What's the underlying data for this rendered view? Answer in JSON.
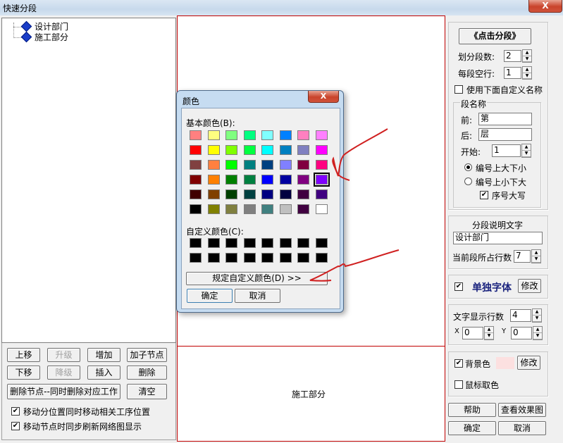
{
  "window": {
    "title": "快速分段",
    "close": "X"
  },
  "tree": {
    "items": [
      "设计部门",
      "施工部分"
    ]
  },
  "left_buttons": {
    "up": "上移",
    "promote": "升级",
    "add": "增加",
    "add_child": "加子节点",
    "down": "下移",
    "demote": "降级",
    "insert": "插入",
    "delete": "删除",
    "delete_node": "删除节点--同时删除对应工作",
    "clear": "清空"
  },
  "left_checks": {
    "move_pos": "移动分位置同时移动相关工序位置",
    "move_refresh": "移动节点时同步刷新网络图显示"
  },
  "canvas": {
    "section2": "施工部分"
  },
  "right": {
    "click_btn": "《点击分段》",
    "seg_count_label": "划分段数:",
    "seg_count": "2",
    "blank_rows_label": "每段空行:",
    "blank_rows": "1",
    "use_custom_label": "使用下面自定义名称",
    "seg_name_group": "段名称",
    "prefix_label": "前:",
    "prefix": "第",
    "suffix_label": "后:",
    "suffix": "层",
    "start_label": "开始:",
    "start": "1",
    "radio1": "编号上大下小",
    "radio2": "编号上小下大",
    "uppercase": "序号大写",
    "desc_group": "分段说明文字",
    "desc_value": "设计部门",
    "rows_label": "当前段所占行数",
    "rows_value": "7",
    "font_label": "单独字体",
    "modify": "修改",
    "display_rows_label": "文字显示行数",
    "display_rows": "4",
    "x_label": "X",
    "x_value": "0",
    "y_label": "Y",
    "y_value": "0",
    "bg_label": "背景色",
    "bg_color": "#fce0e0",
    "modify2": "修改",
    "mouse_pick": "鼠标取色",
    "help": "帮助",
    "preview": "查看效果图",
    "ok": "确定",
    "cancel": "取消"
  },
  "dialog": {
    "title": "颜色",
    "close": "X",
    "basic_label": "基本颜色(B):",
    "custom_label": "自定义颜色(C):",
    "define_btn": "规定自定义颜色(D) >>",
    "ok": "确定",
    "cancel": "取消",
    "basic_colors": [
      "#ff8080",
      "#ffff80",
      "#80ff80",
      "#00ff80",
      "#80ffff",
      "#0080ff",
      "#ff80c0",
      "#ff80ff",
      "#ff0000",
      "#ffff00",
      "#80ff00",
      "#00ff40",
      "#00ffff",
      "#0080c0",
      "#8080c0",
      "#ff00ff",
      "#804040",
      "#ff8040",
      "#00ff00",
      "#008080",
      "#004080",
      "#8080ff",
      "#800040",
      "#ff0080",
      "#800000",
      "#ff8000",
      "#008000",
      "#008040",
      "#0000ff",
      "#0000a0",
      "#800080",
      "#8000ff",
      "#400000",
      "#804000",
      "#004000",
      "#004040",
      "#000080",
      "#000040",
      "#400040",
      "#400080",
      "#000000",
      "#808000",
      "#808040",
      "#808080",
      "#408080",
      "#c0c0c0",
      "#400040",
      "#ffffff"
    ],
    "selected_index": 31,
    "custom_colors": [
      "#000000",
      "#000000",
      "#000000",
      "#000000",
      "#000000",
      "#000000",
      "#000000",
      "#000000",
      "#000000",
      "#000000",
      "#000000",
      "#000000",
      "#000000",
      "#000000",
      "#000000",
      "#000000"
    ]
  }
}
